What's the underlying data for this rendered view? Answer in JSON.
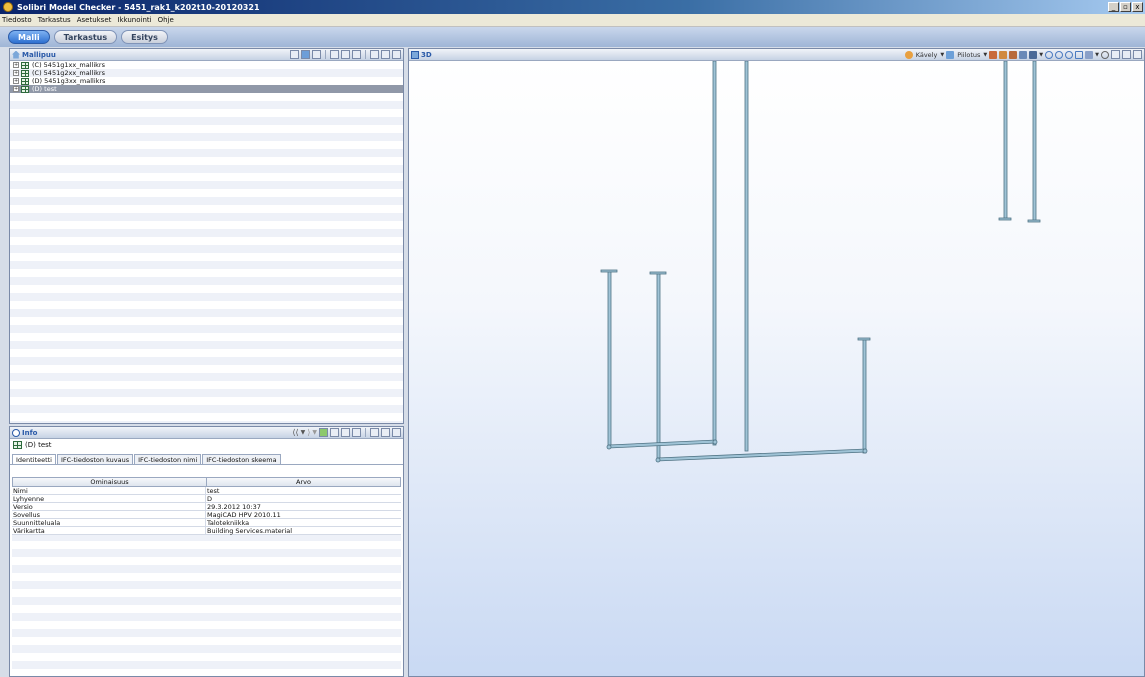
{
  "window": {
    "title": "Solibri Model Checker - 5451_rak1_k202t10-20120321",
    "buttons": [
      "_",
      "▫",
      "x"
    ]
  },
  "menu": [
    "Tiedosto",
    "Tarkastus",
    "Asetukset",
    "Ikkunointi",
    "Ohje"
  ],
  "perspectives": [
    {
      "label": "Malli",
      "active": true
    },
    {
      "label": "Tarkastus",
      "active": false
    },
    {
      "label": "Esitys",
      "active": false
    }
  ],
  "model_tree": {
    "title": "Mallipuu",
    "items": [
      {
        "label": "(C) 5451g1xx_mallikrs",
        "selected": false
      },
      {
        "label": "(C) 5451g2xx_mallikrs",
        "selected": false
      },
      {
        "label": "(D) 5451g3xx_mallikrs",
        "selected": false
      },
      {
        "label": "(D) test",
        "selected": true
      }
    ]
  },
  "info": {
    "title": "Info",
    "selected_item": "(D) test",
    "tabs": [
      "Identiteetti",
      "IFC-tiedoston kuvaus",
      "IFC-tiedoston nimi",
      "IFC-tiedoston skeema"
    ],
    "columns": [
      "Ominaisuus",
      "Arvo"
    ],
    "rows": [
      {
        "prop": "Nimi",
        "value": "test"
      },
      {
        "prop": "Lyhyenne",
        "value": "D"
      },
      {
        "prop": "Versio",
        "value": "29.3.2012 10:37"
      },
      {
        "prop": "Sovellus",
        "value": "MagiCAD HPV 2010.11"
      },
      {
        "prop": "Suunnitteluala",
        "value": "Talotekniikka"
      },
      {
        "prop": "Värikartta",
        "value": "Building Services.material"
      }
    ]
  },
  "view3d": {
    "title": "3D",
    "tools": {
      "walk": "Kävely",
      "hide": "Piilotus"
    }
  },
  "colors": {
    "pipe": "#9fc3d6",
    "pipe_edge": "#4f7384",
    "selection": "#9098a8",
    "accent": "#2a5aa8"
  }
}
